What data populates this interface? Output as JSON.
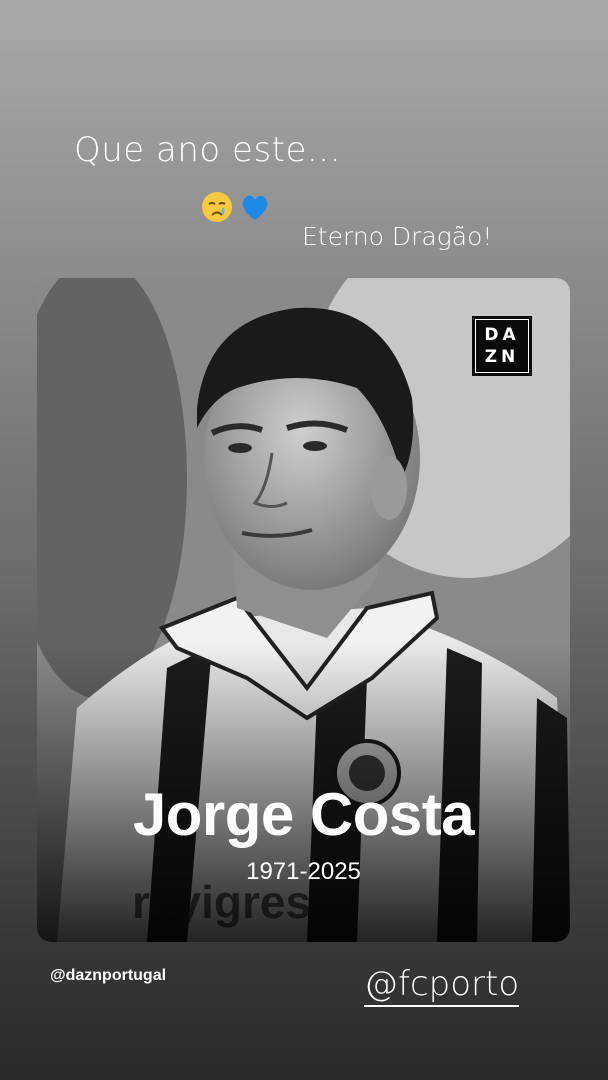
{
  "story": {
    "text_top": "Que ano este...",
    "emoji": [
      "crying-face-emoji",
      "blue-heart-emoji"
    ],
    "text_side": "Eterno Dragão!"
  },
  "post": {
    "logo_text": "DAZN",
    "logo_line1": "DA",
    "logo_line2": "ZN",
    "name": "Jorge Costa",
    "years": "1971-2025",
    "source_handle": "@daznportugal"
  },
  "mention": {
    "handle": "@fcporto"
  }
}
